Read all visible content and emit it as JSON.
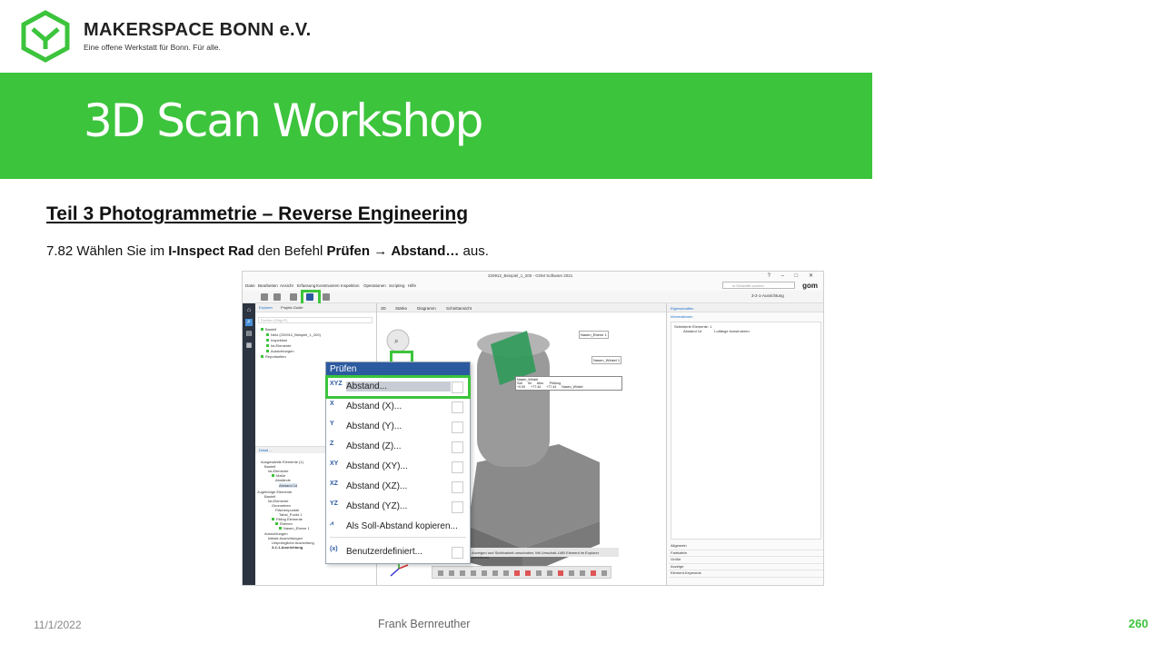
{
  "header": {
    "org_name": "MAKERSPACE BONN e.V.",
    "org_tagline": "Eine offene Werkstatt für Bonn. Für alle.",
    "brand_color": "#3cc43c"
  },
  "banner": {
    "title": "3D Scan Workshop"
  },
  "content": {
    "section_title": "Teil 3  Photogrammetrie  – Reverse Engineering",
    "step_number": "7.82",
    "step_text_1": "Wählen Sie im",
    "step_bold_1": "I-Inspect Rad",
    "step_text_2": "den Befehl",
    "step_bold_2": "Prüfen",
    "step_arrow": "→",
    "step_bold_3": "Abstand…",
    "step_text_3": "aus."
  },
  "software": {
    "window_title": "220912_Beispiel_1_200 - GOM Software 2021",
    "menu": [
      "Datei",
      "Bearbeiten",
      "Ansicht",
      "Erfassung",
      "Konstruieren",
      "Inspektion",
      "Operationen",
      "Scripting",
      "Hilfe"
    ],
    "search_placeholder": "In Einstellfe suchen",
    "brand": "gom",
    "alignment": "3-2-1-Ausrichtung",
    "explorer_tabs": [
      "Explorer",
      "Projekt-Guide"
    ],
    "explorer_search": "Suchen (Strg+F)",
    "explorer_tree": [
      "Bauteil",
      "Netz (220912_Beispiel_1_200)",
      "Inspektion",
      "Ist-Elemente",
      "Ausrichtungen",
      "Reportseiten"
    ],
    "selected_tab": "Detail ...",
    "lower_tree": [
      "Ausgewählte Elemente (1)",
      "Bauteil",
      "Ist-Elemente",
      "Maße",
      "Abstände",
      "Abstand 1d",
      "Zugehörige Elemente",
      "Bauteil",
      "Ist-Elemente",
      "Geometrien",
      "Flächenpunkte",
      "Tabst_Punkt 1",
      "Fitting Elemente",
      "Ebenen",
      "Nasen_Ebene 1",
      "Ausrichtungen",
      "Initiale Ausrichtungen",
      "Ursprüngliche Ausrichtung",
      "3-2-1-Ausrichtung"
    ],
    "viewport_tabs": [
      "3D",
      "Stärke",
      "Diagramm",
      "Schnittansicht"
    ],
    "labels_3d": [
      "Nasen_Ebene 1",
      "Nasen_Winkel 1"
    ],
    "angle_table": {
      "title": "Nasen_Winkel",
      "headers": [
        "Soll",
        "Ist",
        "Abw.",
        "Prüfung"
      ],
      "row": [
        "+0.00",
        "+77.44",
        "+77.44",
        "Nasen_Winkel"
      ]
    },
    "right_panel_head": "Eigenschaften",
    "right_panel_sub": "Informationen",
    "right_panel_item": "Selektierte Elemente: 1",
    "right_panel_row": [
      "Abstand 1d",
      "Lotlänge konstruieren"
    ],
    "right_panel_list": [
      "Allgemein",
      "Farbtafeln",
      "Größe",
      "Anzeige",
      "Element-Keywords"
    ],
    "status_hint": "Anzeigen und Sichtbarkeit umschalten. Mit Umschalt-LMB Element im Explorer selektieren."
  },
  "context_menu": {
    "header": "Prüfen",
    "items": [
      {
        "icon": "XYZ",
        "label": "Abstand..."
      },
      {
        "icon": "X",
        "label": "Abstand (X)..."
      },
      {
        "icon": "Y",
        "label": "Abstand (Y)..."
      },
      {
        "icon": "Z",
        "label": "Abstand (Z)..."
      },
      {
        "icon": "XY",
        "label": "Abstand (XY)..."
      },
      {
        "icon": "XZ",
        "label": "Abstand (XZ)..."
      },
      {
        "icon": "YZ",
        "label": "Abstand (YZ)..."
      },
      {
        "icon": "dist-icon",
        "label": "Als Soll-Abstand kopieren..."
      },
      {
        "icon": "custom-icon",
        "label": "Benutzerdefiniert..."
      }
    ]
  },
  "footer": {
    "date": "11/1/2022",
    "author": "Frank Bernreuther",
    "page": "260"
  }
}
